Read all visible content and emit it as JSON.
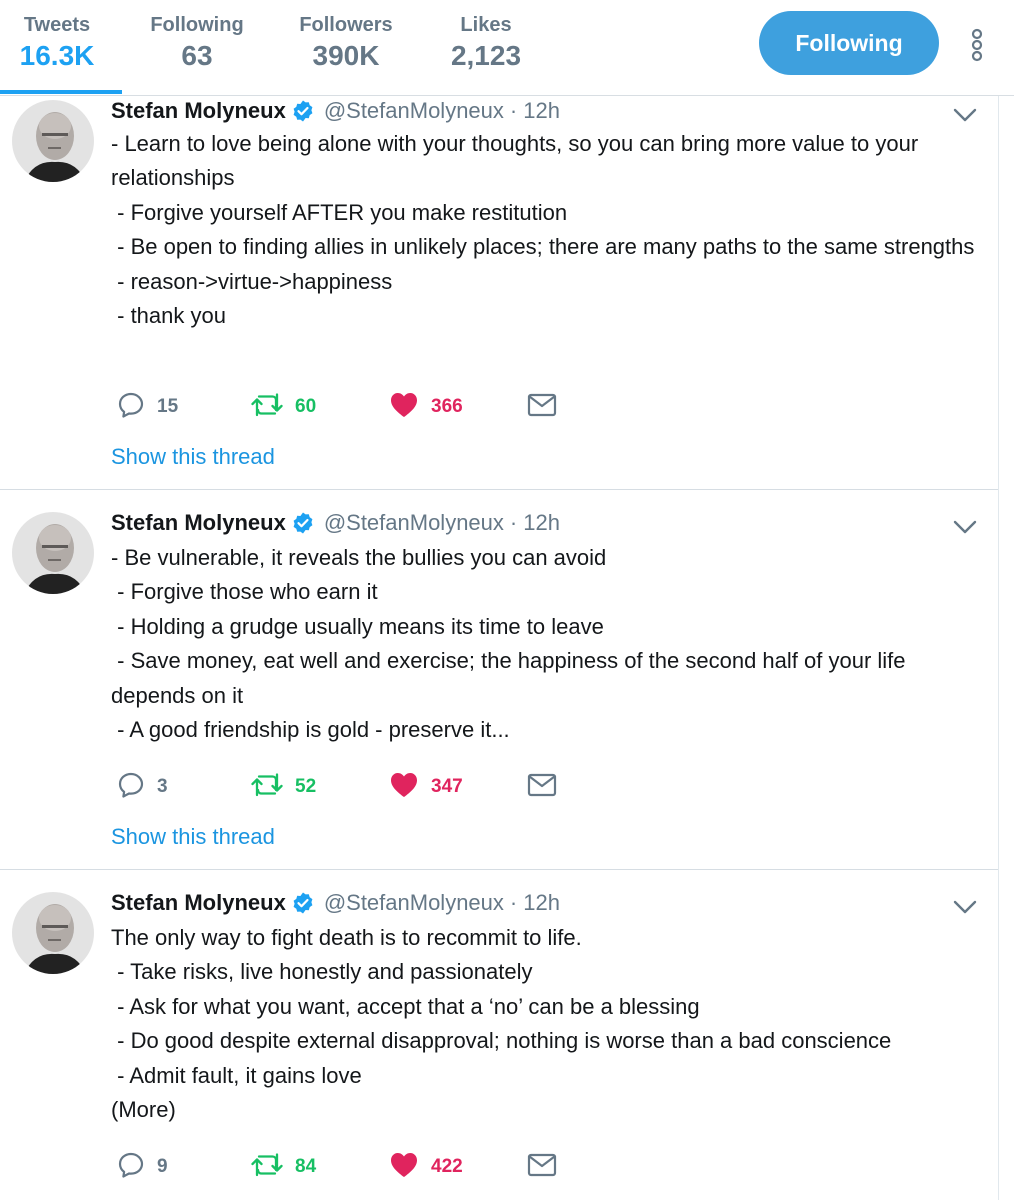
{
  "nav": {
    "stats": [
      {
        "label": "Tweets",
        "value": "16.3K",
        "active": true
      },
      {
        "label": "Following",
        "value": "63",
        "active": false
      },
      {
        "label": "Followers",
        "value": "390K",
        "active": false
      },
      {
        "label": "Likes",
        "value": "2,123",
        "active": false
      }
    ],
    "follow_button": "Following",
    "more_icon": "vertical-dots-icon"
  },
  "colors": {
    "accent": "#1da1f2",
    "follow_button": "#3ea0de",
    "retweet": "#17bf63",
    "like": "#e0245e",
    "muted": "#657786"
  },
  "tweets": [
    {
      "name": "Stefan Molyneux",
      "verified": true,
      "handle": "@StefanMolyneux",
      "separator": "·",
      "time": "12h",
      "text": "- Learn to love being alone with your thoughts, so you can bring more value to your relationships\n - Forgive yourself AFTER you make restitution\n - Be open to finding allies in unlikely places; there are many paths to the same strengths\n - reason->virtue->happiness\n - thank you",
      "replies": "15",
      "retweets": "60",
      "likes": "366",
      "show_thread": "Show this thread"
    },
    {
      "name": "Stefan Molyneux",
      "verified": true,
      "handle": "@StefanMolyneux",
      "separator": "·",
      "time": "12h",
      "text": "- Be vulnerable, it reveals the bullies you can avoid\n - Forgive those who earn it\n - Holding a grudge usually means its time to leave\n - Save money, eat well and exercise; the happiness of the second half of your life depends on it\n - A good friendship is gold - preserve it...",
      "replies": "3",
      "retweets": "52",
      "likes": "347",
      "show_thread": "Show this thread"
    },
    {
      "name": "Stefan Molyneux",
      "verified": true,
      "handle": "@StefanMolyneux",
      "separator": "·",
      "time": "12h",
      "text": "The only way to fight death is to recommit to life.\n - Take risks, live honestly and passionately\n - Ask for what you want, accept that a ‘no’ can be a blessing\n - Do good despite external disapproval; nothing is worse than a bad conscience\n - Admit fault, it gains love\n(More)",
      "replies": "9",
      "retweets": "84",
      "likes": "422"
    }
  ]
}
